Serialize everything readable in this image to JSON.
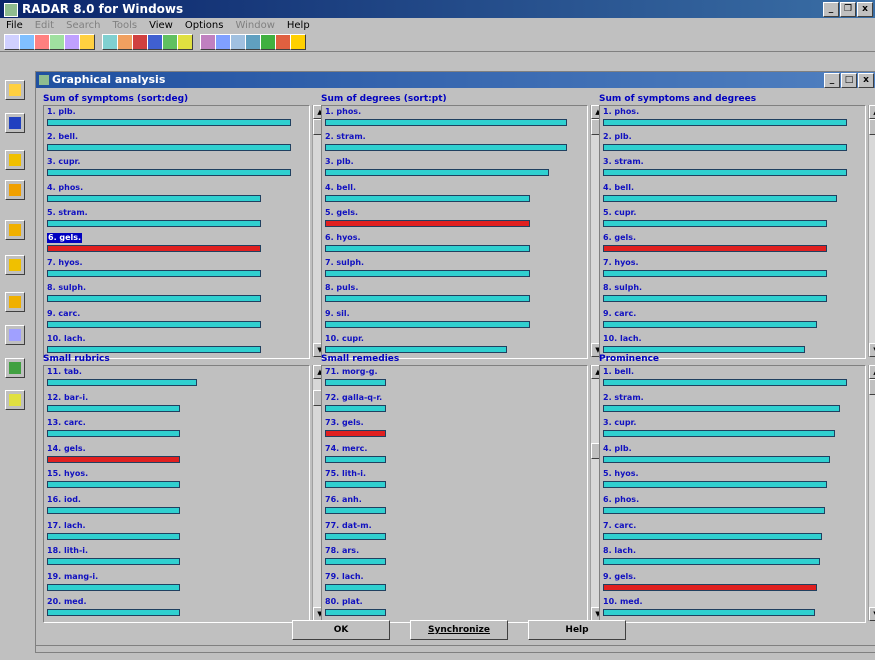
{
  "app": {
    "title": "RADAR 8.0 for Windows"
  },
  "menu": [
    {
      "label": "File",
      "disabled": false
    },
    {
      "label": "Edit",
      "disabled": true
    },
    {
      "label": "Search",
      "disabled": true
    },
    {
      "label": "Tools",
      "disabled": true
    },
    {
      "label": "View",
      "disabled": false
    },
    {
      "label": "Options",
      "disabled": false
    },
    {
      "label": "Window",
      "disabled": true
    },
    {
      "label": "Help",
      "disabled": false
    }
  ],
  "window": {
    "title": "Graphical analysis"
  },
  "panels": [
    {
      "title": "Sum of symptoms (sort:deg)",
      "items": [
        {
          "label": "1. plb.",
          "value": 0.98
        },
        {
          "label": "2. bell.",
          "value": 0.98
        },
        {
          "label": "3. cupr.",
          "value": 0.98
        },
        {
          "label": "4. phos.",
          "value": 0.86
        },
        {
          "label": "5. stram.",
          "value": 0.86
        },
        {
          "label": "6. gels.",
          "value": 0.86,
          "highlight": true,
          "selected": true
        },
        {
          "label": "7. hyos.",
          "value": 0.86
        },
        {
          "label": "8. sulph.",
          "value": 0.86
        },
        {
          "label": "9. carc.",
          "value": 0.86
        },
        {
          "label": "10. lach.",
          "value": 0.86
        }
      ],
      "scroll": {
        "thumb": 0.0
      }
    },
    {
      "title": "Sum of degrees (sort:pt)",
      "items": [
        {
          "label": "1. phos.",
          "value": 0.97
        },
        {
          "label": "2. stram.",
          "value": 0.97
        },
        {
          "label": "3. plb.",
          "value": 0.9
        },
        {
          "label": "4. bell.",
          "value": 0.82
        },
        {
          "label": "5. gels.",
          "value": 0.82,
          "highlight": true
        },
        {
          "label": "6. hyos.",
          "value": 0.82
        },
        {
          "label": "7. sulph.",
          "value": 0.82
        },
        {
          "label": "8. puls.",
          "value": 0.82
        },
        {
          "label": "9. sil.",
          "value": 0.82
        },
        {
          "label": "10. cupr.",
          "value": 0.73
        }
      ],
      "scroll": {
        "thumb": 0.0
      }
    },
    {
      "title": "Sum of symptoms and degrees",
      "items": [
        {
          "label": "1. phos.",
          "value": 0.98
        },
        {
          "label": "2. plb.",
          "value": 0.98
        },
        {
          "label": "3. stram.",
          "value": 0.98
        },
        {
          "label": "4. bell.",
          "value": 0.94
        },
        {
          "label": "5. cupr.",
          "value": 0.9
        },
        {
          "label": "6. gels.",
          "value": 0.9,
          "highlight": true
        },
        {
          "label": "7. hyos.",
          "value": 0.9
        },
        {
          "label": "8. sulph.",
          "value": 0.9
        },
        {
          "label": "9. carc.",
          "value": 0.86
        },
        {
          "label": "10. lach.",
          "value": 0.81
        }
      ],
      "scroll": {
        "thumb": 0.0
      }
    },
    {
      "title": "Small rubrics",
      "items": [
        {
          "label": "11. tab.",
          "value": 0.6
        },
        {
          "label": "12. bar-i.",
          "value": 0.53
        },
        {
          "label": "13. carc.",
          "value": 0.53
        },
        {
          "label": "14. gels.",
          "value": 0.53,
          "highlight": true
        },
        {
          "label": "15. hyos.",
          "value": 0.53
        },
        {
          "label": "16. iod.",
          "value": 0.53
        },
        {
          "label": "17. lach.",
          "value": 0.53
        },
        {
          "label": "18. lith-i.",
          "value": 0.53
        },
        {
          "label": "19. mang-i.",
          "value": 0.53
        },
        {
          "label": "20. med.",
          "value": 0.53
        }
      ],
      "scroll": {
        "thumb": 0.05
      }
    },
    {
      "title": "Small remedies",
      "items": [
        {
          "label": "71. morg-g.",
          "value": 0.24
        },
        {
          "label": "72. galla-q-r.",
          "value": 0.24
        },
        {
          "label": "73. gels.",
          "value": 0.24,
          "highlight": true
        },
        {
          "label": "74. merc.",
          "value": 0.24
        },
        {
          "label": "75. lith-i.",
          "value": 0.24
        },
        {
          "label": "76. anh.",
          "value": 0.24
        },
        {
          "label": "77. dat-m.",
          "value": 0.24
        },
        {
          "label": "78. ars.",
          "value": 0.24
        },
        {
          "label": "79. lach.",
          "value": 0.24
        },
        {
          "label": "80. plat.",
          "value": 0.24
        }
      ],
      "scroll": {
        "thumb": 0.3
      }
    },
    {
      "title": "Prominence",
      "items": [
        {
          "label": "1. bell.",
          "value": 0.98
        },
        {
          "label": "2. stram.",
          "value": 0.95
        },
        {
          "label": "3. cupr.",
          "value": 0.93
        },
        {
          "label": "4. plb.",
          "value": 0.91
        },
        {
          "label": "5. hyos.",
          "value": 0.9
        },
        {
          "label": "6. phos.",
          "value": 0.89
        },
        {
          "label": "7. carc.",
          "value": 0.88
        },
        {
          "label": "8. lach.",
          "value": 0.87
        },
        {
          "label": "9. gels.",
          "value": 0.86,
          "highlight": true
        },
        {
          "label": "10. med.",
          "value": 0.85
        }
      ],
      "scroll": {
        "thumb": 0.0
      }
    }
  ],
  "buttons": {
    "ok": "OK",
    "synchronize": "Synchronize",
    "help": "Help"
  },
  "colors": {
    "bar": "#30d0d0",
    "highlight": "#e02020",
    "label": "#1010c0",
    "title_bar": "#0a246a"
  }
}
